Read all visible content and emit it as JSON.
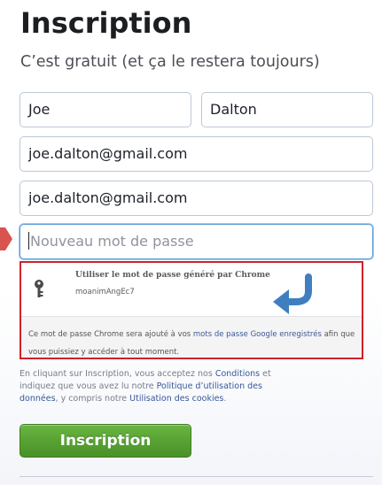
{
  "header": {
    "title": "Inscription",
    "subtitle": "C’est gratuit (et ça le restera toujours)"
  },
  "form": {
    "first_name": "Joe",
    "last_name": "Dalton",
    "email": "joe.dalton@gmail.com",
    "email_confirm": "joe.dalton@gmail.com",
    "password_placeholder": "Nouveau mot de passe"
  },
  "password_suggestion": {
    "title": "Utiliser le mot de passe généré par Chrome",
    "generated_password": "moanimAngEc7",
    "note_part1": "Ce mot de passe Chrome sera ajouté à vos ",
    "note_link": "mots de passe Google enregistrés",
    "note_part2": " afin que vous puissiez y accéder à tout moment.",
    "icon": "key-icon",
    "annotation_icon": "curved-arrow-icon"
  },
  "terms": {
    "part1": "En cliquant sur Inscription, vous acceptez nos ",
    "link1": "Conditions",
    "part2": " et indiquez que vous avez lu notre ",
    "link2": "Politique d’utilisation des données",
    "part3": ", y compris notre ",
    "link3": "Utilisation des cookies",
    "part4": "."
  },
  "submit": {
    "label": "Inscription"
  },
  "colors": {
    "submit_green": "#58a233",
    "highlight_red": "#d0212b",
    "annotation_blue": "#3f7fc0",
    "link_blue": "#365899"
  }
}
